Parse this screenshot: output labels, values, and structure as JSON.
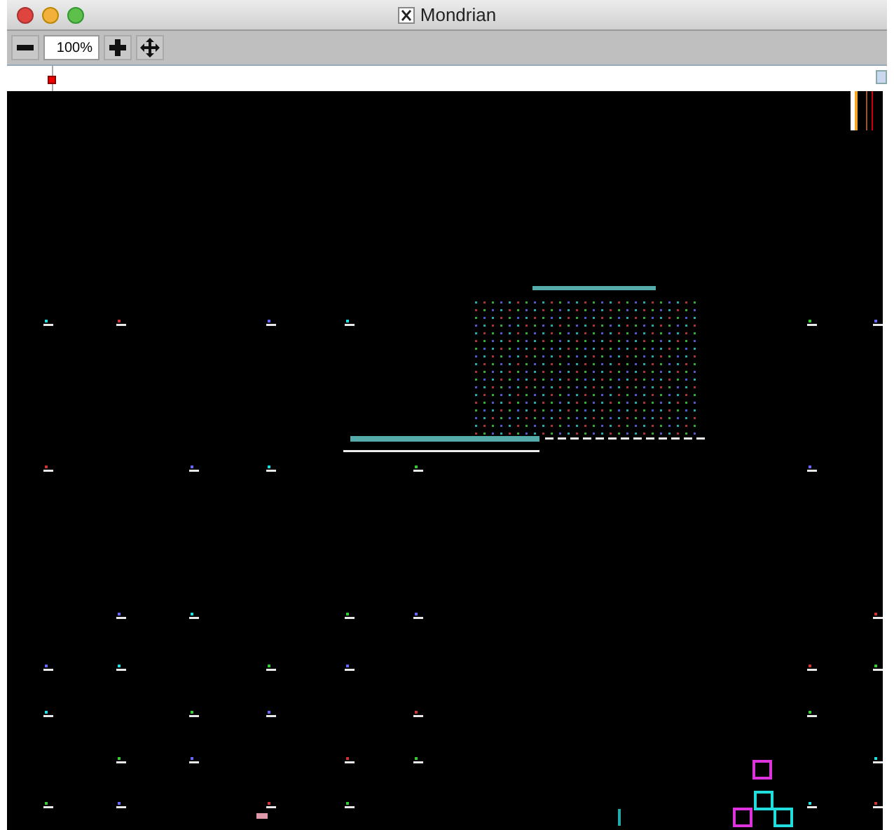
{
  "window": {
    "title": "Mondrian"
  },
  "toolbar": {
    "zoom_field": {
      "value": "100%"
    }
  }
}
